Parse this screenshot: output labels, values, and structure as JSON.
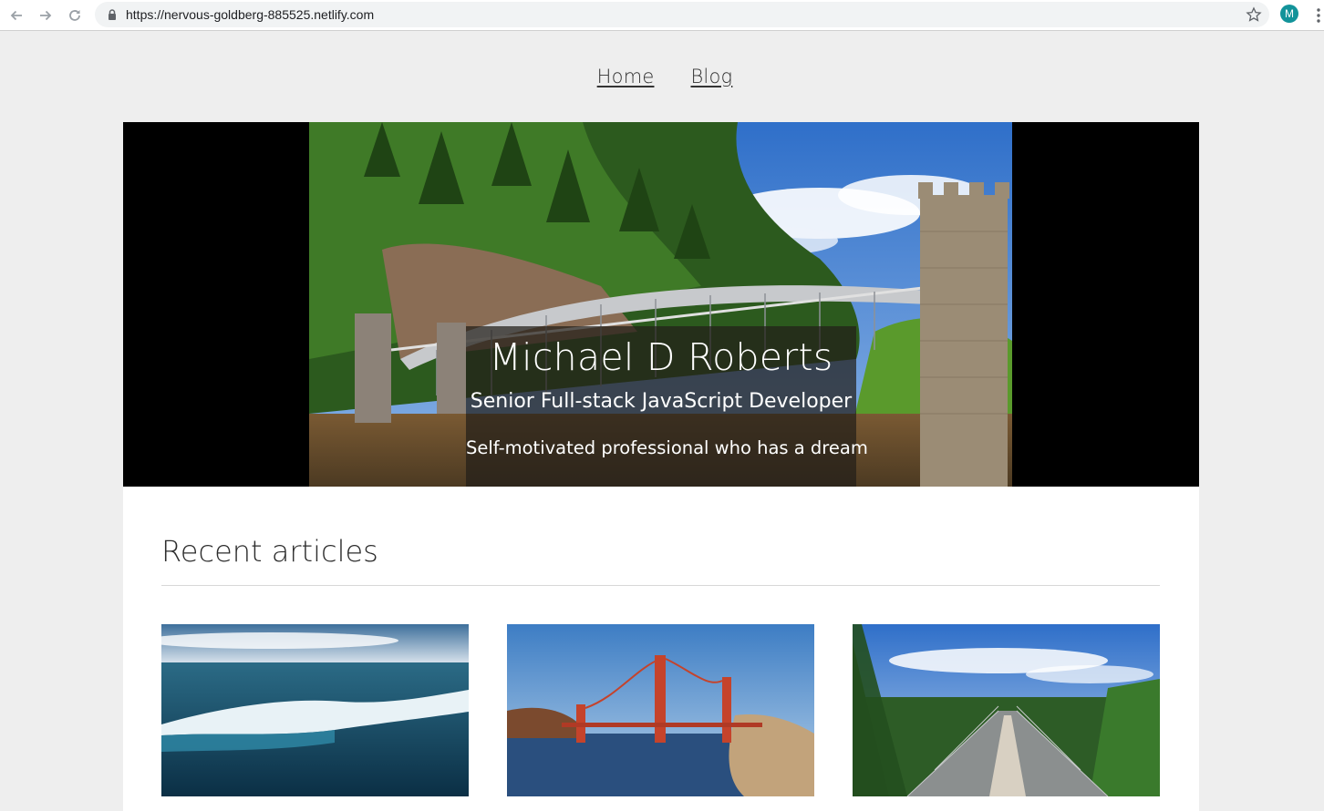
{
  "browser": {
    "url": "https://nervous-goldberg-885525.netlify.com",
    "profile_initial": "M",
    "icons": [
      "back-arrow-icon",
      "forward-arrow-icon",
      "reload-icon",
      "lock-icon",
      "star-icon",
      "more-vert-icon"
    ]
  },
  "nav": {
    "home": "Home",
    "blog": "Blog"
  },
  "hero": {
    "name": "Michael D Roberts",
    "role": "Senior Full-stack JavaScript Developer",
    "tagline": "Self-motivated professional who has a dream"
  },
  "articles": {
    "heading": "Recent articles"
  },
  "colors": {
    "page_bg": "#eeeeee",
    "content_bg": "#ffffff",
    "hero_bg": "#000000",
    "avatar": "#12939a"
  }
}
